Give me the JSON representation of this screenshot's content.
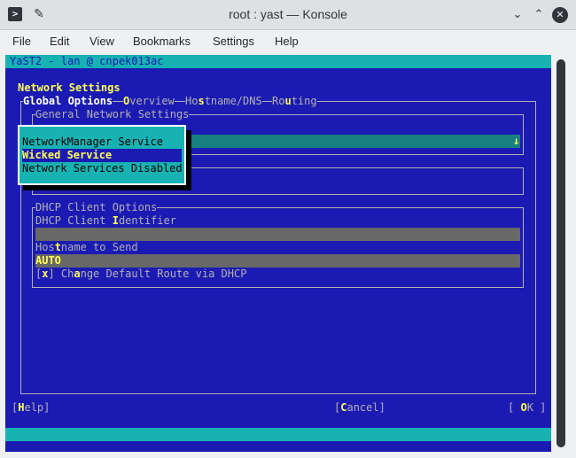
{
  "window": {
    "title": "root : yast — Konsole",
    "app_icon": "terminal-icon",
    "pin_icon": "pin-icon",
    "minimize_glyph": "⌄",
    "maximize_glyph": "⌃",
    "close_glyph": "✕"
  },
  "menubar": [
    "File",
    "Edit",
    "View",
    "Bookmarks",
    "Settings",
    "Help"
  ],
  "yast": {
    "header": "YaST2 - lan @ cnpek013ac",
    "page_title": "Network Settings",
    "tabs": [
      {
        "label": "Global Options",
        "selected": true
      },
      {
        "label": "Overview",
        "hotkey": "v"
      },
      {
        "label": "Hostname/DNS",
        "hotkey": "s"
      },
      {
        "label": "Routing",
        "hotkey": "u"
      }
    ],
    "general_frame_title": "General Network Settings",
    "combo_arrow": "↓",
    "network_setup_options": [
      {
        "label": "NetworkManager Service",
        "selected": false
      },
      {
        "label": "Wicked Service",
        "selected": true
      },
      {
        "label": "Network Services Disabled",
        "selected": false
      }
    ],
    "dhcp_frame_title": "DHCP Client Options",
    "dhcp_identifier_label": "DHCP Client Identifier",
    "dhcp_identifier_value": "",
    "hostname_label": "Hostname to Send",
    "hostname_value": "AUTO",
    "default_route_checkbox": "[x]",
    "default_route_label": "Change Default Route via DHCP",
    "buttons": {
      "help": "Help",
      "cancel": "Cancel",
      "ok": "OK"
    }
  },
  "colors": {
    "terminal_bg": "#1b1bb3",
    "cyan": "#18b2b2",
    "hotkey": "#ffff54",
    "label": "#b2b2b2",
    "field": "#686868"
  }
}
